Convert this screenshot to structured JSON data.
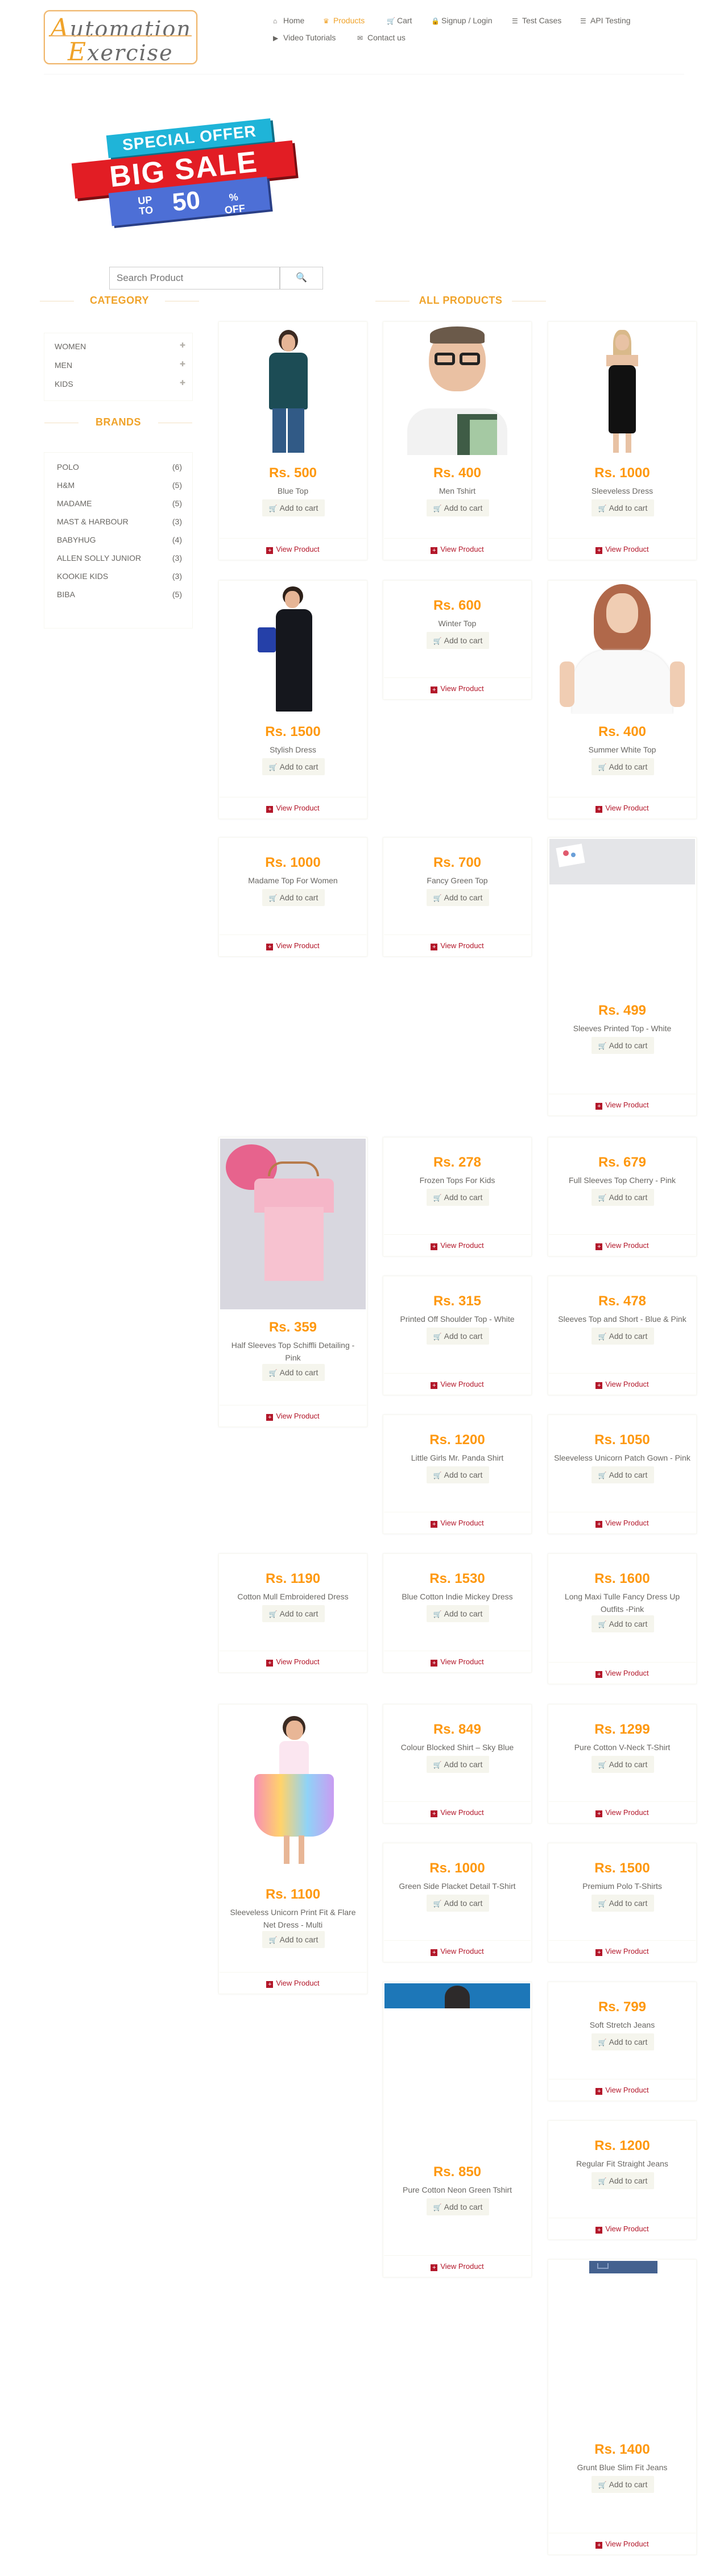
{
  "logo": {
    "line1": "utomation",
    "line1_cap": "A",
    "line2": "xercise",
    "line2_cap": "E"
  },
  "nav": [
    {
      "label": "Home",
      "icon": "home-icon",
      "glyph": "⌂"
    },
    {
      "label": "Products",
      "icon": "shirt-icon",
      "glyph": "♛"
    },
    {
      "label": "Cart",
      "icon": "cart-icon",
      "glyph": "🛒"
    },
    {
      "label": "Signup / Login",
      "icon": "lock-icon",
      "glyph": "🔒"
    },
    {
      "label": "Test Cases",
      "icon": "list-icon",
      "glyph": "☰"
    },
    {
      "label": "API Testing",
      "icon": "list-icon",
      "glyph": "☰"
    },
    {
      "label": "Video Tutorials",
      "icon": "youtube-icon",
      "glyph": "▶"
    },
    {
      "label": "Contact us",
      "icon": "envelope-icon",
      "glyph": "✉"
    }
  ],
  "banner": {
    "line1": "SPECIAL OFFER",
    "line2": "BIG SALE",
    "up": "UP",
    "to": "TO",
    "percent": "50",
    "pct": "%",
    "off": "OFF"
  },
  "search": {
    "placeholder": "Search Product",
    "button_glyph": "🔍"
  },
  "sidebar": {
    "category_title": "CATEGORY",
    "categories": [
      {
        "label": "WOMEN"
      },
      {
        "label": "MEN"
      },
      {
        "label": "KIDS"
      }
    ],
    "brands_title": "BRANDS",
    "brands": [
      {
        "label": "POLO",
        "count": "(6)"
      },
      {
        "label": "H&M",
        "count": "(5)"
      },
      {
        "label": "MADAME",
        "count": "(5)"
      },
      {
        "label": "MAST & HARBOUR",
        "count": "(3)"
      },
      {
        "label": "BABYHUG",
        "count": "(4)"
      },
      {
        "label": "ALLEN SOLLY JUNIOR",
        "count": "(3)"
      },
      {
        "label": "KOOKIE KIDS",
        "count": "(3)"
      },
      {
        "label": "BIBA",
        "count": "(5)"
      }
    ]
  },
  "products_title": "ALL PRODUCTS",
  "product_actions": {
    "add": "Add to cart",
    "view": "View Product"
  },
  "products": [
    {
      "price": "Rs. 500",
      "name": "Blue Top"
    },
    {
      "price": "Rs. 400",
      "name": "Men Tshirt"
    },
    {
      "price": "Rs. 1000",
      "name": "Sleeveless Dress"
    },
    {
      "price": "Rs. 1500",
      "name": "Stylish Dress"
    },
    {
      "price": "Rs. 600",
      "name": "Winter Top"
    },
    {
      "price": "Rs. 400",
      "name": "Summer White Top"
    },
    {
      "price": "Rs. 1000",
      "name": "Madame Top For Women"
    },
    {
      "price": "Rs. 700",
      "name": "Fancy Green Top"
    },
    {
      "price": "Rs. 499",
      "name": "Sleeves Printed Top - White"
    },
    {
      "price": "Rs. 359",
      "name": "Half Sleeves Top Schiffli Detailing - Pink"
    },
    {
      "price": "Rs. 278",
      "name": "Frozen Tops For Kids"
    },
    {
      "price": "Rs. 679",
      "name": "Full Sleeves Top Cherry - Pink"
    },
    {
      "price": "Rs. 315",
      "name": "Printed Off Shoulder Top - White"
    },
    {
      "price": "Rs. 478",
      "name": "Sleeves Top and Short - Blue & Pink"
    },
    {
      "price": "Rs. 1200",
      "name": "Little Girls Mr. Panda Shirt"
    },
    {
      "price": "Rs. 1050",
      "name": "Sleeveless Unicorn Patch Gown - Pink"
    },
    {
      "price": "Rs. 1190",
      "name": "Cotton Mull Embroidered Dress"
    },
    {
      "price": "Rs. 1530",
      "name": "Blue Cotton Indie Mickey Dress"
    },
    {
      "price": "Rs. 1600",
      "name": "Long Maxi Tulle Fancy Dress Up Outfits -Pink"
    },
    {
      "price": "Rs. 1100",
      "name": "Sleeveless Unicorn Print Fit & Flare Net Dress - Multi"
    },
    {
      "price": "Rs. 849",
      "name": "Colour Blocked Shirt – Sky Blue"
    },
    {
      "price": "Rs. 1299",
      "name": "Pure Cotton V-Neck T-Shirt"
    },
    {
      "price": "Rs. 1000",
      "name": "Green Side Placket Detail T-Shirt"
    },
    {
      "price": "Rs. 1500",
      "name": "Premium Polo T-Shirts"
    },
    {
      "price": "Rs. 850",
      "name": "Pure Cotton Neon Green Tshirt"
    },
    {
      "price": "Rs. 799",
      "name": "Soft Stretch Jeans"
    },
    {
      "price": "Rs. 1200",
      "name": "Regular Fit Straight Jeans"
    },
    {
      "price": "Rs. 1400",
      "name": "Grunt Blue Slim Fit Jeans"
    }
  ]
}
